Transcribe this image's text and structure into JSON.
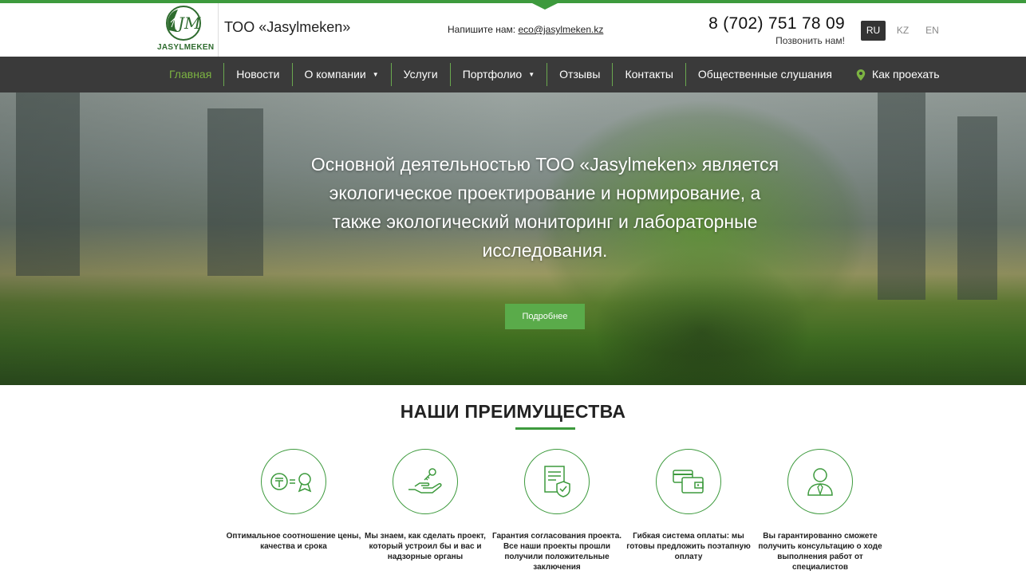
{
  "header": {
    "logo_text": "JASYLMEKEN",
    "company_name": "ТОО «Jasylmeken»",
    "email_label": "Напишите нам:",
    "email": "eco@jasylmeken.kz",
    "phone": "8 (702) 751 78 09",
    "call_label": "Позвонить нам!",
    "languages": [
      "RU",
      "KZ",
      "EN"
    ],
    "active_language": "RU"
  },
  "nav": {
    "items": [
      {
        "label": "Главная"
      },
      {
        "label": "Новости"
      },
      {
        "label": "О компании"
      },
      {
        "label": "Услуги"
      },
      {
        "label": "Портфолио"
      },
      {
        "label": "Отзывы"
      },
      {
        "label": "Контакты"
      },
      {
        "label": "Общественные слушания"
      },
      {
        "label": "Как проехать"
      }
    ]
  },
  "hero": {
    "text": "Основной деятельностью ТОО «Jasylmeken» является экологическое проектирование и нормирование, а также экологический мониторинг и лабораторные исследования.",
    "button": "Подробнее"
  },
  "advantages": {
    "title": "НАШИ ПРЕИМУЩЕСТВА",
    "items": [
      {
        "icon": "price-quality-icon",
        "text": "Оптимальное соотношение цены, качества и срока"
      },
      {
        "icon": "hand-key-icon",
        "text": "Мы знаем, как сделать проект, который устроил бы и вас и надзорные органы"
      },
      {
        "icon": "document-shield-icon",
        "text": "Гарантия согласования проекта. Все наши проекты прошли получили положительные заключения"
      },
      {
        "icon": "wallet-cards-icon",
        "text": "Гибкая система оплаты: мы готовы предложить поэтапную оплату"
      },
      {
        "icon": "consultant-icon",
        "text": "Вы гарантированно сможете получить консультацию о ходе выполнения работ от специалистов"
      }
    ]
  },
  "colors": {
    "accent": "#3d9a3d",
    "nav_bg": "#3a3a3a",
    "nav_active": "#7cb342"
  }
}
